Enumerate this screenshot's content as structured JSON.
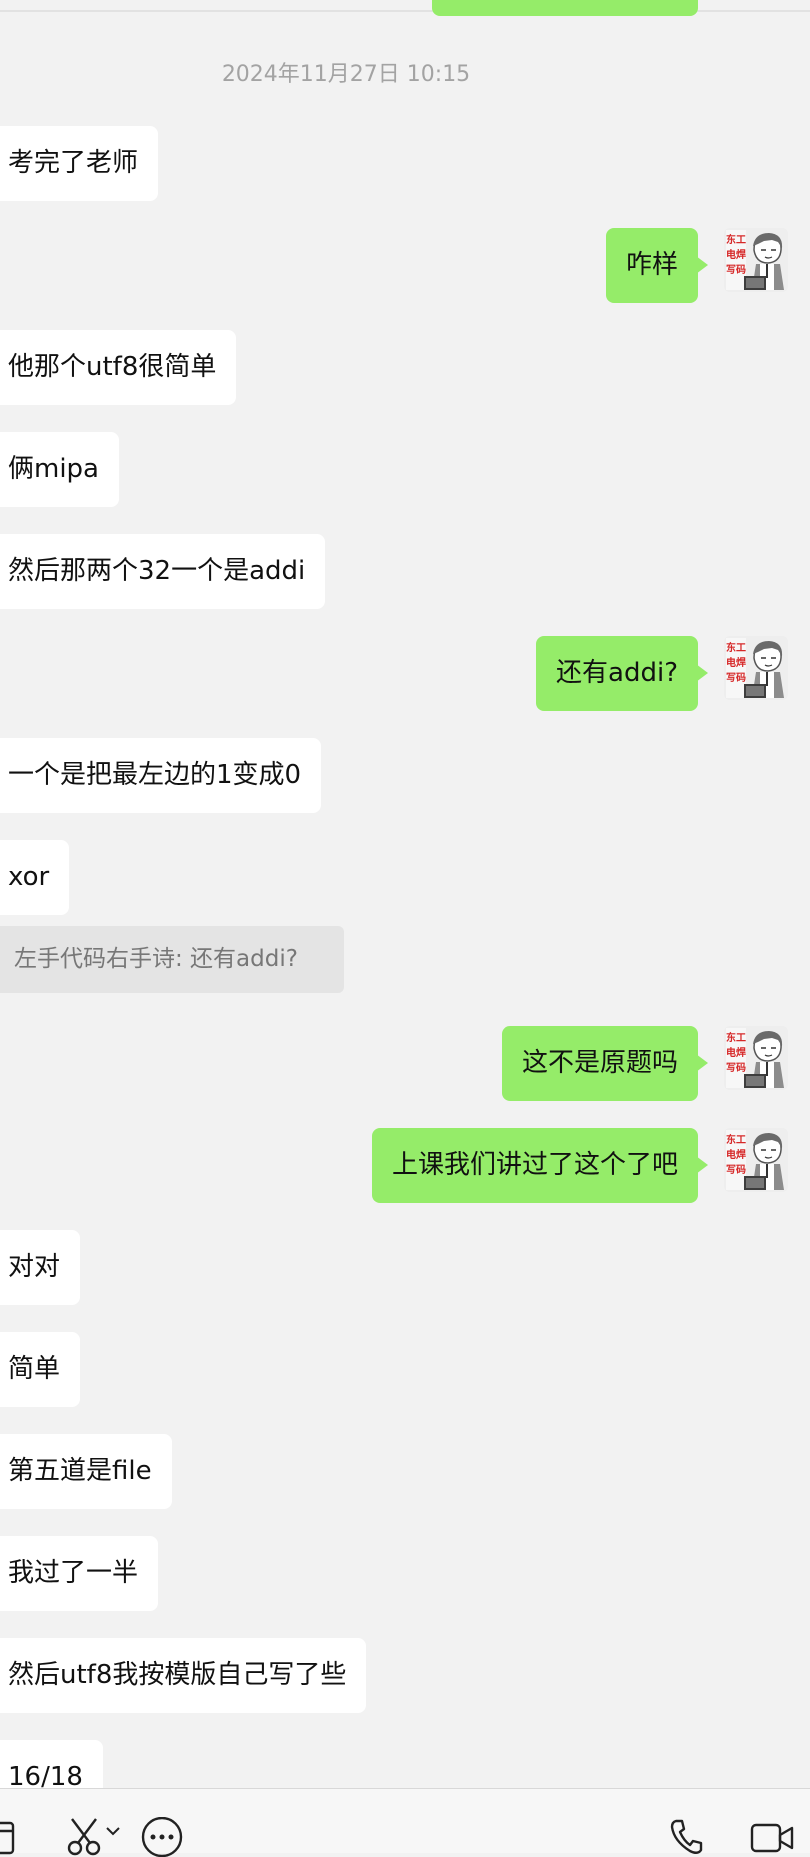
{
  "timestamp": "2024年11月27日 10:15",
  "messages": [
    {
      "side": "in",
      "text": "考完了老师"
    },
    {
      "side": "out",
      "text": "咋样"
    },
    {
      "side": "in",
      "text": "他那个utf8很简单"
    },
    {
      "side": "in",
      "text": "俩mipa"
    },
    {
      "side": "in",
      "text": "然后那两个32一个是addi"
    },
    {
      "side": "out",
      "text": "还有addi?"
    },
    {
      "side": "in",
      "text": "一个是把最左边的1变成0"
    },
    {
      "side": "in",
      "text": "xor"
    },
    {
      "side": "out",
      "text": "这不是原题吗"
    },
    {
      "side": "out",
      "text": "上课我们讲过了这个了吧"
    },
    {
      "side": "in",
      "text": "对对"
    },
    {
      "side": "in",
      "text": "简单"
    },
    {
      "side": "in",
      "text": "第五道是file"
    },
    {
      "side": "in",
      "text": "我过了一半"
    },
    {
      "side": "in",
      "text": "然后utf8我按模版自己写了些"
    },
    {
      "side": "in",
      "text": "16/18"
    }
  ],
  "quote": {
    "text": "左手代码右手诗: 还有addi?"
  },
  "avatar": {
    "sticker_text": [
      "东工",
      "电焊",
      "写码"
    ],
    "icon": "cartoon-person-at-laptop-avatar"
  },
  "toolbar": {
    "icons": [
      "sidebar-icon",
      "scissors-icon",
      "chevron-down-icon",
      "chat-bubble-more-icon",
      "phone-icon",
      "video-camera-icon"
    ]
  },
  "colors": {
    "background": "#f2f2f2",
    "incoming_bubble": "#ffffff",
    "outgoing_bubble": "#95ec69",
    "quote_bg": "#e4e4e4",
    "timestamp_text": "#a3a3a3"
  }
}
